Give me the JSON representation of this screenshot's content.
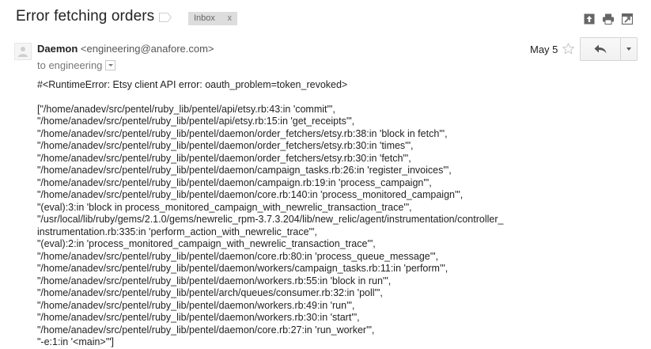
{
  "email": {
    "subject": "Error fetching orders",
    "label_chip": "Inbox",
    "label_chip_remove": "x",
    "sender_name": "Daemon",
    "sender_email": "<engineering@anafore.com>",
    "to_text": "to engineering",
    "date": "May 5",
    "icons": {
      "label": "label-icon",
      "print": "print-icon",
      "new_window": "new-window-icon",
      "expand": "expand-icon",
      "star": "star-icon",
      "reply": "reply-icon",
      "more": "chevron-down-icon"
    },
    "error_line": "#<RuntimeError: Etsy client API error: oauth_problem=token_revoked>",
    "trace_lines": [
      "[\"/home/anadev/src/pentel/ruby_lib/pentel/api/etsy.rb:43:in 'commit'\",",
      " \"/home/anadev/src/pentel/ruby_lib/pentel/api/etsy.rb:15:in 'get_receipts'\",",
      " \"/home/anadev/src/pentel/ruby_lib/pentel/daemon/order_fetchers/etsy.rb:38:in 'block in fetch'\",",
      " \"/home/anadev/src/pentel/ruby_lib/pentel/daemon/order_fetchers/etsy.rb:30:in 'times'\",",
      " \"/home/anadev/src/pentel/ruby_lib/pentel/daemon/order_fetchers/etsy.rb:30:in 'fetch'\",",
      " \"/home/anadev/src/pentel/ruby_lib/pentel/daemon/campaign_tasks.rb:26:in 'register_invoices'\",",
      " \"/home/anadev/src/pentel/ruby_lib/pentel/daemon/campaign.rb:19:in 'process_campaign'\",",
      " \"/home/anadev/src/pentel/ruby_lib/pentel/daemon/core.rb:140:in 'process_monitored_campaign'\",",
      " \"(eval):3:in 'block in process_monitored_campaign_with_newrelic_transaction_trace'\",",
      " \"/usr/local/lib/ruby/gems/2.1.0/gems/newrelic_rpm-3.7.3.204/lib/new_relic/agent/instrumentation/controller_",
      "instrumentation.rb:335:in 'perform_action_with_newrelic_trace'\",",
      " \"(eval):2:in 'process_monitored_campaign_with_newrelic_transaction_trace'\",",
      " \"/home/anadev/src/pentel/ruby_lib/pentel/daemon/core.rb:80:in 'process_queue_message'\",",
      " \"/home/anadev/src/pentel/ruby_lib/pentel/daemon/workers/campaign_tasks.rb:11:in 'perform'\",",
      " \"/home/anadev/src/pentel/ruby_lib/pentel/daemon/workers.rb:55:in 'block in run'\",",
      " \"/home/anadev/src/pentel/ruby_lib/pentel/arch/queues/consumer.rb:32:in 'poll'\",",
      " \"/home/anadev/src/pentel/ruby_lib/pentel/daemon/workers.rb:49:in 'run'\",",
      " \"/home/anadev/src/pentel/ruby_lib/pentel/daemon/workers.rb:30:in 'start'\",",
      " \"/home/anadev/src/pentel/ruby_lib/pentel/daemon/core.rb:27:in 'run_worker'\",",
      " \"-e:1:in '<main>'\"]"
    ]
  }
}
